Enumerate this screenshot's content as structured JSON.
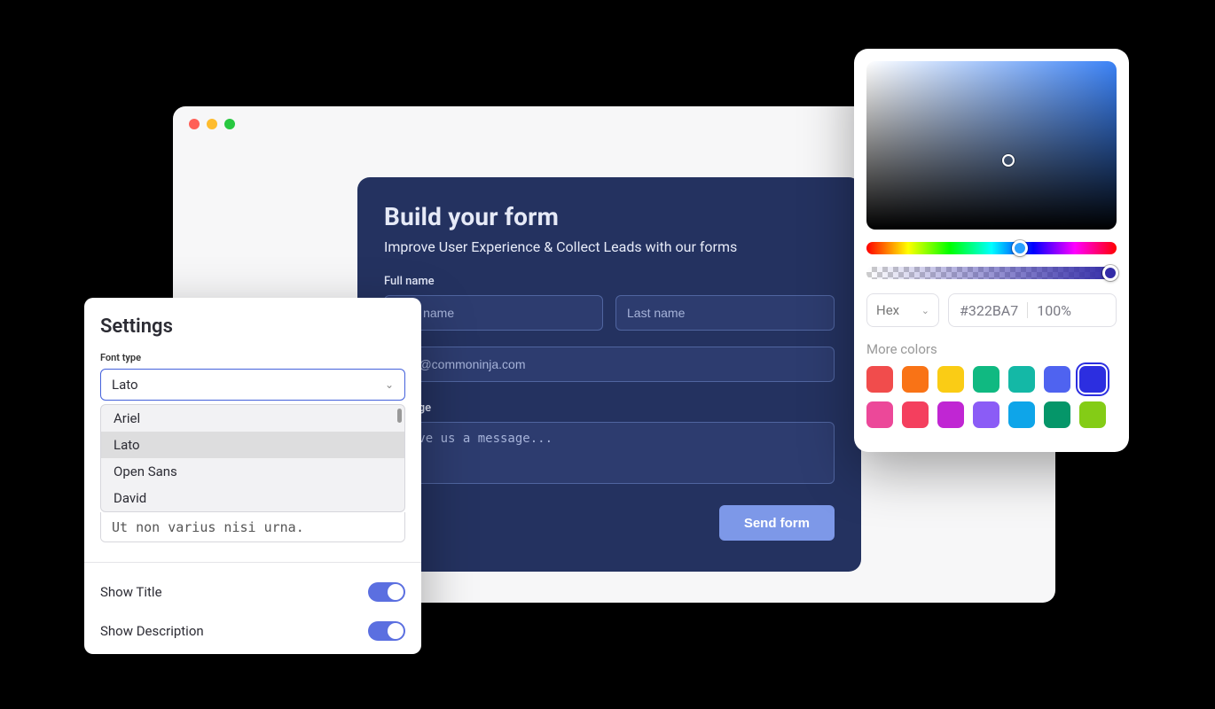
{
  "browser": {
    "traffic": {
      "red": "#ff5f57",
      "yellow": "#febc2e",
      "green": "#28c840"
    }
  },
  "form": {
    "title": "Build your form",
    "subtitle": "Improve User Experience & Collect Leads with our forms",
    "fullname_label": "Full name",
    "firstname_placeholder": "First name",
    "lastname_placeholder": "Last name",
    "email_placeholder": "john@commoninja.com",
    "message_label": "Message",
    "message_placeholder": "Leave us a message...",
    "submit_label": "Send form"
  },
  "settings": {
    "title": "Settings",
    "font_type_label": "Font type",
    "selected_font": "Lato",
    "dropdown_options": [
      "Ariel",
      "Lato",
      "Open Sans",
      "David"
    ],
    "textarea_text": "Ut non varius nisi urna.",
    "show_title_label": "Show Title",
    "show_title_on": true,
    "show_description_label": "Show Description",
    "show_description_on": true
  },
  "colorpicker": {
    "format_label": "Hex",
    "hex_value": "#322BA7",
    "alpha_value": "100%",
    "more_colors_label": "More colors",
    "swatches_row1": [
      "#f14c4c",
      "#f97316",
      "#facc15",
      "#10b981",
      "#14b8a6",
      "#4f63f0",
      "#2c2ee0"
    ],
    "swatches_row2": [
      "#ec4899",
      "#f43f5e",
      "#c026d3",
      "#8b5cf6",
      "#0ea5e9",
      "#059669",
      "#84cc16"
    ],
    "selected_swatch_index": 6
  }
}
